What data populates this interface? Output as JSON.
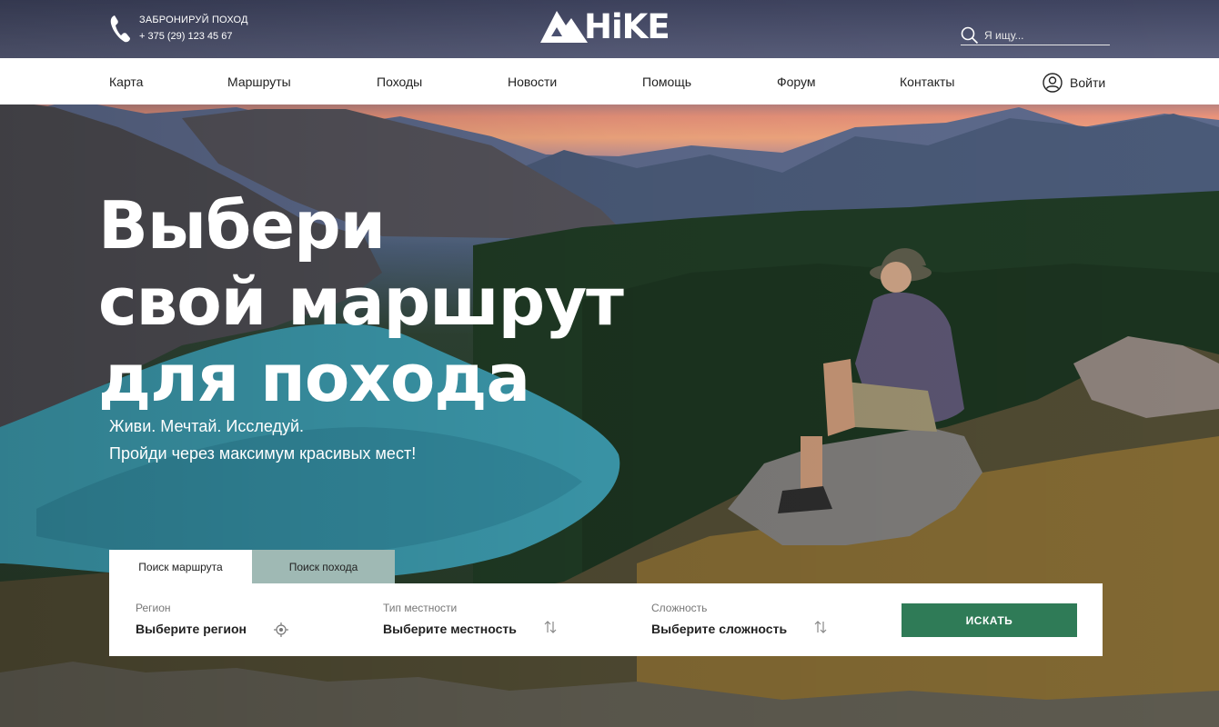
{
  "header": {
    "booking_label": "ЗАБРОНИРУЙ ПОХОД",
    "phone": "+ 375 (29) 123 45 67",
    "logo_text": "HiKE",
    "search_placeholder": "Я ищу..."
  },
  "nav": {
    "items": [
      {
        "label": "Карта"
      },
      {
        "label": "Маршруты"
      },
      {
        "label": "Походы"
      },
      {
        "label": "Новости"
      },
      {
        "label": "Помощь"
      },
      {
        "label": "Форум"
      },
      {
        "label": "Контакты"
      }
    ],
    "login_label": "Войти"
  },
  "hero": {
    "title_line1": "Выбери",
    "title_line2": "свой маршрут",
    "title_line3": "для похода",
    "subtitle_line1": "Живи. Мечтай. Исследуй.",
    "subtitle_line2": "Пройди через максимум красивых мест!"
  },
  "search_panel": {
    "tabs": [
      {
        "label": "Поиск маршрута",
        "active": true
      },
      {
        "label": "Поиск похода",
        "active": false
      }
    ],
    "fields": [
      {
        "label": "Регион",
        "value": "Выберите регион",
        "icon": "location-target-icon"
      },
      {
        "label": "Тип местности",
        "value": "Выберите местность",
        "icon": "sort-arrows-icon"
      },
      {
        "label": "Сложность",
        "value": "Выберите сложность",
        "icon": "sort-arrows-icon"
      }
    ],
    "submit_label": "ИСКАТЬ"
  },
  "colors": {
    "accent_green": "#2f7b57",
    "inactive_tab": "#9fb9b4",
    "nav_bg": "#ffffff"
  }
}
